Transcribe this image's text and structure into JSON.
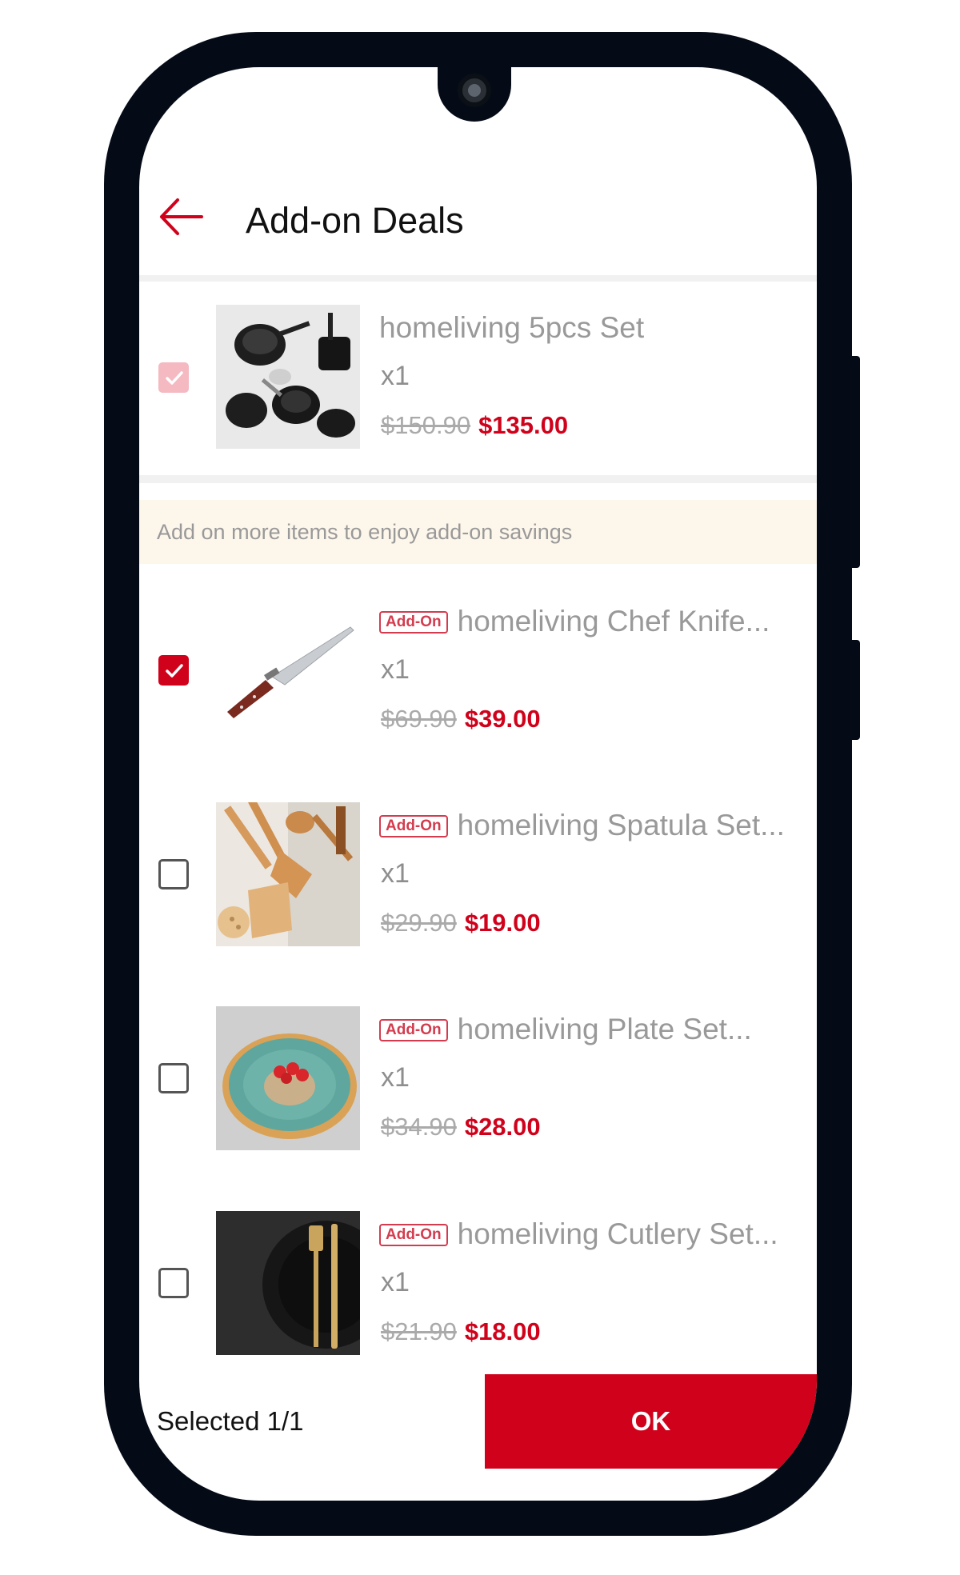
{
  "header": {
    "title": "Add-on Deals"
  },
  "main_item": {
    "name": "homeliving 5pcs Set",
    "qty": "x1",
    "old_price": "$150.90",
    "new_price": "$135.00",
    "checked": true
  },
  "banner": {
    "text": "Add on more items to enjoy add-on savings"
  },
  "addon_tag": "Add-On",
  "addons": [
    {
      "name": "homeliving Chef Knife...",
      "qty": "x1",
      "old_price": "$69.90",
      "new_price": "$39.00",
      "checked": true
    },
    {
      "name": "homeliving Spatula Set...",
      "qty": "x1",
      "old_price": "$29.90",
      "new_price": "$19.00",
      "checked": false
    },
    {
      "name": "homeliving Plate Set...",
      "qty": "x1",
      "old_price": "$34.90",
      "new_price": "$28.00",
      "checked": false
    },
    {
      "name": "homeliving Cutlery Set...",
      "qty": "x1",
      "old_price": "$21.90",
      "new_price": "$18.00",
      "checked": false
    }
  ],
  "footer": {
    "selected_label": "Selected 1/1",
    "ok_label": "OK"
  },
  "colors": {
    "accent": "#d0021b",
    "phone_frame": "#040b16",
    "banner_bg": "#fdf6eb"
  },
  "icons": {
    "back": "arrow-left-icon",
    "check": "checkmark-icon"
  }
}
